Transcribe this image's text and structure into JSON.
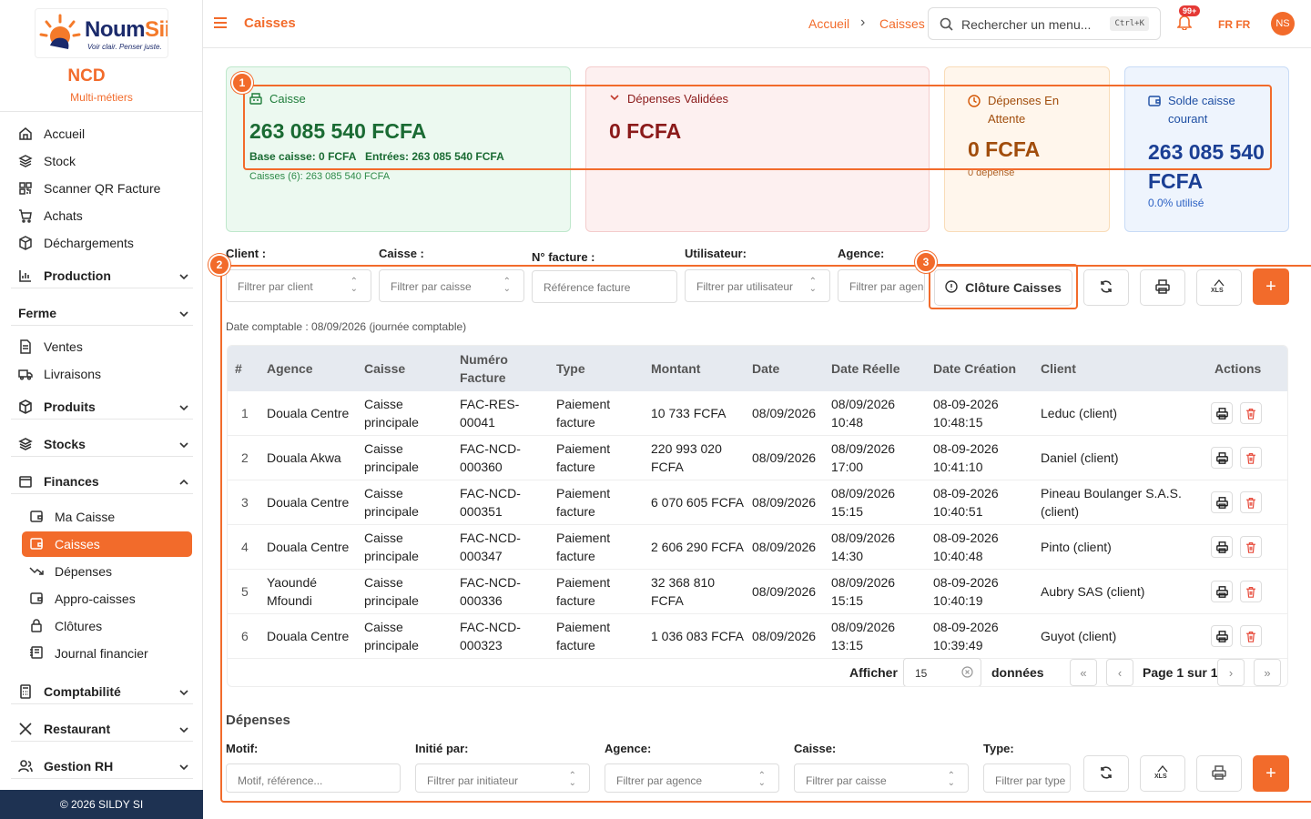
{
  "brand": {
    "name_part1": "Noum",
    "name_part2": "Sii",
    "tagline": "Voir clair. Penser juste.",
    "accent": "#f26b2b",
    "navy": "#1b2a6b"
  },
  "org": {
    "name": "NCD",
    "subtitle": "Multi-métiers"
  },
  "sidebar": {
    "items": [
      {
        "label": "Accueil",
        "icon": "home-icon"
      },
      {
        "label": "Stock",
        "icon": "layers-icon"
      },
      {
        "label": "Scanner QR Facture",
        "icon": "qr-icon"
      },
      {
        "label": "Achats",
        "icon": "cart-icon"
      },
      {
        "label": "Déchargements",
        "icon": "box-icon"
      }
    ],
    "groups": [
      {
        "label": "Production",
        "icon": "chart-icon"
      },
      {
        "label": "Ferme",
        "icon": ""
      },
      {
        "label": "Produits",
        "icon": "box-icon"
      },
      {
        "label": "Stocks",
        "icon": "layers-icon"
      },
      {
        "label": "Finances",
        "icon": "folder-icon"
      },
      {
        "label": "Comptabilité",
        "icon": "calculator-icon"
      },
      {
        "label": "Restaurant",
        "icon": "utensils-icon"
      },
      {
        "label": "Gestion RH",
        "icon": "users-icon"
      }
    ],
    "ferme_items": [
      {
        "label": "Ventes",
        "icon": "document-icon"
      },
      {
        "label": "Livraisons",
        "icon": "truck-icon"
      }
    ],
    "finance_items": [
      {
        "label": "Ma Caisse",
        "icon": "wallet-icon"
      },
      {
        "label": "Caisses",
        "icon": "wallet-icon"
      },
      {
        "label": "Dépenses",
        "icon": "trend-down-icon"
      },
      {
        "label": "Appro-caisses",
        "icon": "wallet-icon"
      },
      {
        "label": "Clôtures",
        "icon": "lock-icon"
      },
      {
        "label": "Journal financier",
        "icon": "journal-icon"
      }
    ],
    "footer": "© 2026 SILDY SI"
  },
  "header": {
    "title": "Caisses",
    "breadcrumb": [
      "Accueil",
      "Caisses"
    ],
    "search_placeholder": "Rechercher un menu...",
    "shortcut": "Ctrl+K",
    "notif_badge": "99+",
    "lang": "FR  FR",
    "avatar": "NS"
  },
  "cards": {
    "caisse": {
      "title": "Caisse",
      "amount": "263 085 540 FCFA",
      "base": "Base caisse: 0 FCFA",
      "entrees": "Entrées: 263 085 540 FCFA",
      "detail": "Caisses (6): 263 085 540 FCFA"
    },
    "depenses_validees": {
      "title": "Dépenses Validées",
      "amount": "0 FCFA"
    },
    "depenses_attente": {
      "title_line1": "Dépenses En",
      "title_line2": "Attente",
      "amount": "0 FCFA",
      "detail": "0 dépense"
    },
    "solde": {
      "title_line1": "Solde caisse",
      "title_line2": "courant",
      "amount_line1": "263 085 540",
      "amount_line2": "FCFA",
      "detail": "0.0% utilisé"
    }
  },
  "annotations": [
    "1",
    "2",
    "3"
  ],
  "filters": {
    "client": {
      "label": "Client :",
      "placeholder": "Filtrer par client"
    },
    "caisse": {
      "label": "Caisse :",
      "placeholder": "Filtrer par caisse"
    },
    "facture": {
      "label": "N° facture :",
      "placeholder": "Référence facture"
    },
    "utilisateur": {
      "label": "Utilisateur:",
      "placeholder": "Filtrer par utilisateur"
    },
    "agence": {
      "label": "Agence:",
      "placeholder": "Filtrer par agence"
    },
    "cloture_button": "Clôture Caisses",
    "xls": "XLS",
    "plus": "+"
  },
  "date_comptable": "Date comptable : 08/09/2026 (journée comptable)",
  "table": {
    "headers": [
      "#",
      "Agence",
      "Caisse",
      "Numéro Facture",
      "Type",
      "Montant",
      "Date",
      "Date Réelle",
      "Date Création",
      "Client",
      "Actions"
    ],
    "header_numero_l1": "Numéro",
    "header_numero_l2": "Facture",
    "rows": [
      {
        "n": "1",
        "agence": "Douala Centre",
        "agence2": "",
        "caisse1": "Caisse",
        "caisse2": "principale",
        "fac1": "FAC-RES-",
        "fac2": "00041",
        "type1": "Paiement",
        "type2": "facture",
        "mont1": "10 733 FCFA",
        "mont2": "",
        "date": "08/09/2026",
        "dr1": "08/09/2026",
        "dr2": "10:48",
        "dc1": "08-09-2026",
        "dc2": "10:48:15",
        "client1": "Leduc (client)",
        "client2": ""
      },
      {
        "n": "2",
        "agence": "Douala Akwa",
        "agence2": "",
        "caisse1": "Caisse",
        "caisse2": "principale",
        "fac1": "FAC-NCD-",
        "fac2": "000360",
        "type1": "Paiement",
        "type2": "facture",
        "mont1": "220 993 020",
        "mont2": "FCFA",
        "date": "08/09/2026",
        "dr1": "08/09/2026",
        "dr2": "17:00",
        "dc1": "08-09-2026",
        "dc2": "10:41:10",
        "client1": "Daniel (client)",
        "client2": ""
      },
      {
        "n": "3",
        "agence": "Douala Centre",
        "agence2": "",
        "caisse1": "Caisse",
        "caisse2": "principale",
        "fac1": "FAC-NCD-",
        "fac2": "000351",
        "type1": "Paiement",
        "type2": "facture",
        "mont1": "6 070 605 FCFA",
        "mont2": "",
        "date": "08/09/2026",
        "dr1": "08/09/2026",
        "dr2": "15:15",
        "dc1": "08-09-2026",
        "dc2": "10:40:51",
        "client1": "Pineau Boulanger S.A.S.",
        "client2": "(client)"
      },
      {
        "n": "4",
        "agence": "Douala Centre",
        "agence2": "",
        "caisse1": "Caisse",
        "caisse2": "principale",
        "fac1": "FAC-NCD-",
        "fac2": "000347",
        "type1": "Paiement",
        "type2": "facture",
        "mont1": "2 606 290 FCFA",
        "mont2": "",
        "date": "08/09/2026",
        "dr1": "08/09/2026",
        "dr2": "14:30",
        "dc1": "08-09-2026",
        "dc2": "10:40:48",
        "client1": "Pinto (client)",
        "client2": ""
      },
      {
        "n": "5",
        "agence": "Yaoundé",
        "agence2": "Mfoundi",
        "caisse1": "Caisse",
        "caisse2": "principale",
        "fac1": "FAC-NCD-",
        "fac2": "000336",
        "type1": "Paiement",
        "type2": "facture",
        "mont1": "32 368 810",
        "mont2": "FCFA",
        "date": "08/09/2026",
        "dr1": "08/09/2026",
        "dr2": "15:15",
        "dc1": "08-09-2026",
        "dc2": "10:40:19",
        "client1": "Aubry SAS (client)",
        "client2": ""
      },
      {
        "n": "6",
        "agence": "Douala Centre",
        "agence2": "",
        "caisse1": "Caisse",
        "caisse2": "principale",
        "fac1": "FAC-NCD-",
        "fac2": "000323",
        "type1": "Paiement",
        "type2": "facture",
        "mont1": "1 036 083 FCFA",
        "mont2": "",
        "date": "08/09/2026",
        "dr1": "08/09/2026",
        "dr2": "13:15",
        "dc1": "08-09-2026",
        "dc2": "10:39:49",
        "client1": "Guyot (client)",
        "client2": ""
      }
    ],
    "pager": {
      "show_label": "Afficher",
      "rows_value": "15",
      "rows_label": "données",
      "page_text": "Page 1 sur 1"
    }
  },
  "depenses": {
    "title": "Dépenses",
    "motif": {
      "label": "Motif:",
      "placeholder": "Motif, référence..."
    },
    "initie": {
      "label": "Initié par:",
      "placeholder": "Filtrer par initiateur"
    },
    "agence": {
      "label": "Agence:",
      "placeholder": "Filtrer par agence"
    },
    "caisse": {
      "label": "Caisse:",
      "placeholder": "Filtrer par caisse"
    },
    "type": {
      "label": "Type:",
      "placeholder": "Filtrer par type"
    }
  }
}
